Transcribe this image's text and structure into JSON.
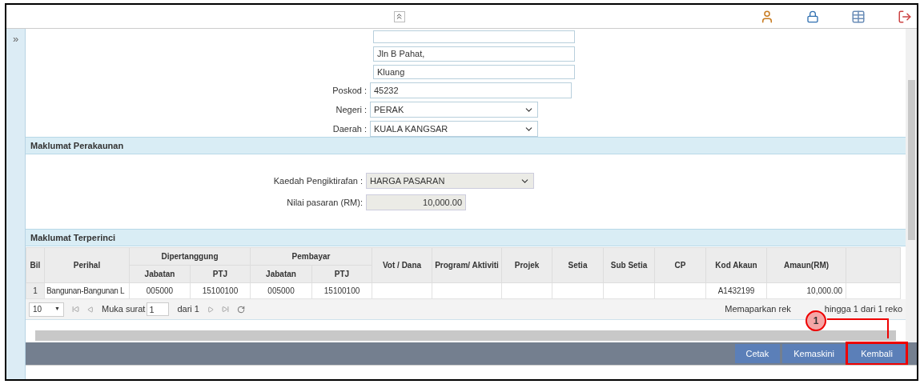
{
  "sidebar": {
    "toggle": "»"
  },
  "address": {
    "lines": [
      "Jln B Pahat,",
      "Kluang"
    ],
    "fields": [
      {
        "kind": "text",
        "label": "Poskod :",
        "value": "45232"
      },
      {
        "kind": "select",
        "label": "Negeri :",
        "value": "PERAK"
      },
      {
        "kind": "select",
        "label": "Daerah :",
        "value": "KUALA KANGSAR"
      }
    ]
  },
  "accounting": {
    "title": "Maklumat Perakaunan",
    "fields": [
      {
        "kind": "select",
        "label": "Kaedah Pengiktirafan :",
        "value": "HARGA PASARAN"
      },
      {
        "kind": "amount",
        "label": "Nilai pasaran (RM):",
        "value": "10,000.00"
      }
    ]
  },
  "details": {
    "title": "Maklumat Terperinci",
    "table": {
      "group_columns": [
        {
          "label": "Bil"
        },
        {
          "label": "Perihal"
        },
        {
          "label": "Dipertanggung",
          "sub_columns": [
            "Jabatan",
            "PTJ"
          ]
        },
        {
          "label": "Pembayar",
          "sub_columns": [
            "Jabatan",
            "PTJ"
          ]
        },
        {
          "label": "Vot / Dana"
        },
        {
          "label": "Program/ Aktiviti"
        },
        {
          "label": "Projek"
        },
        {
          "label": "Setia"
        },
        {
          "label": "Sub Setia"
        },
        {
          "label": "CP"
        },
        {
          "label": "Kod Akaun"
        },
        {
          "label": "Amaun(RM)"
        }
      ],
      "rows": [
        [
          "1",
          "Bangunan-Bangunan L",
          "005000",
          "15100100",
          "005000",
          "15100100",
          "",
          "",
          "",
          "",
          "",
          "",
          "A1432199",
          "10,000.00"
        ]
      ]
    },
    "pager": {
      "page_size": "10",
      "page_size_arrow": "▼",
      "page_label": "Muka surat",
      "page": "1",
      "of_label": "dari 1",
      "status_left": "Memaparkan rek",
      "status_right": "hingga 1 dari 1 reko"
    }
  },
  "buttons": [
    {
      "label": "Cetak",
      "highlighted": false
    },
    {
      "label": "Kemaskini",
      "highlighted": false
    },
    {
      "label": "Kembali",
      "highlighted": true
    }
  ],
  "callout": {
    "number": "1"
  }
}
